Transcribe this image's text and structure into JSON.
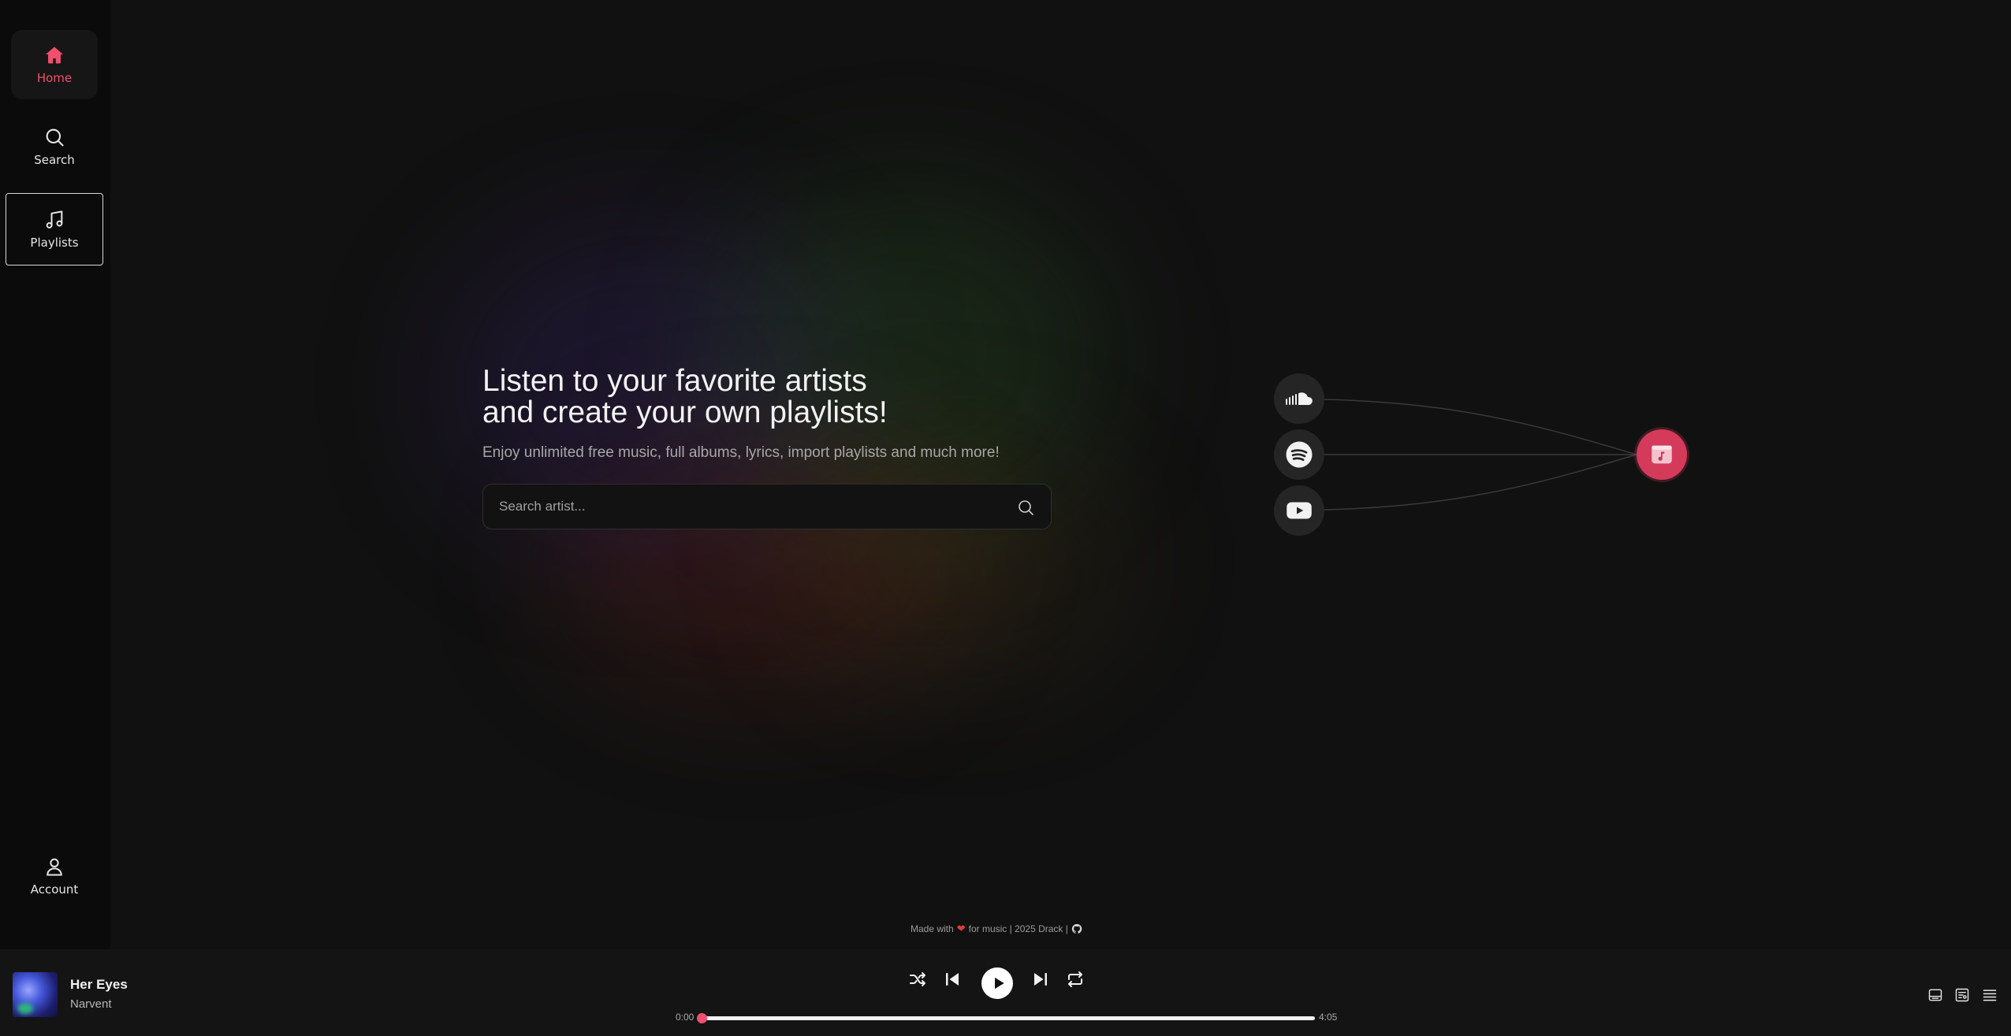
{
  "sidebar": {
    "items": [
      {
        "label": "Home",
        "icon": "home-icon",
        "active": true
      },
      {
        "label": "Search",
        "icon": "search-icon"
      },
      {
        "label": "Playlists",
        "icon": "music-note-icon"
      }
    ],
    "account": {
      "label": "Account",
      "icon": "user-icon"
    }
  },
  "hero": {
    "title_line1": "Listen to your favorite artists",
    "title_line2": "and create your own playlists!",
    "subtitle": "Enjoy unlimited free music, full albums, lyrics, import playlists and much more!",
    "search_placeholder": "Search artist..."
  },
  "diagram": {
    "sources": [
      "soundcloud-icon",
      "spotify-icon",
      "youtube-icon"
    ],
    "destination": "app-music-icon"
  },
  "footer": {
    "made_with": "Made with",
    "for_music": "for music | 2025 Drack |"
  },
  "player": {
    "track_title": "Her Eyes",
    "track_artist": "Narvent",
    "current_time": "0:00",
    "duration": "4:05",
    "progress": 0
  },
  "colors": {
    "accent": "#f0506e",
    "background": "#111111",
    "sidebar": "#0b0b0b",
    "player": "#141414"
  }
}
